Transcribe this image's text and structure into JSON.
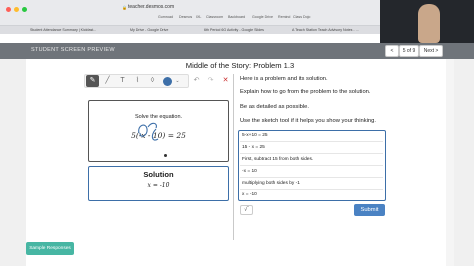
{
  "browser": {
    "url": "teacher.desmos.com",
    "bookmarks": [
      "Gumroad",
      "Desmos",
      "IXL",
      "Classroom",
      "Backboard",
      "Google Drive",
      "Remind",
      "Class Dojo"
    ],
    "tabs": [
      "Student Attendance Summary | Kickfast...",
      "My Drive - Google Drive",
      "6th Period 6G Activity - Google Slides",
      "A Teach Station Teach Advisory Notes - ..."
    ]
  },
  "preview": {
    "title": "STUDENT SCREEN PREVIEW",
    "prev_label": "<",
    "page_indicator": "5 of 9",
    "next_label": "Next >"
  },
  "activity": {
    "title": "Middle of the Story: Problem 1.3"
  },
  "card1": {
    "prompt": "Solve the equation.",
    "equation": "5(-x - 10) = 25"
  },
  "card2": {
    "heading": "Solution",
    "answer": "x = -10"
  },
  "instructions": [
    "Here is a problem and its solution.",
    "Explain how to go from the problem to the solution.",
    "Be as detailed as possible.",
    "Use the sketch tool if it helps you show your thinking."
  ],
  "answer_lines": [
    "5-x+10 = 25",
    "15 - x = 25",
    "First, subtract 15 from both sides.",
    "-x = 10",
    "multiplying both sides by -1",
    "x = -10"
  ],
  "controls": {
    "sqrt_label": "√‾",
    "submit_label": "Submit",
    "sample_label": "Sample Responses"
  },
  "colors": {
    "accent": "#4a82c3",
    "sample": "#47b6a3",
    "preview_bar": "#6f747a"
  }
}
